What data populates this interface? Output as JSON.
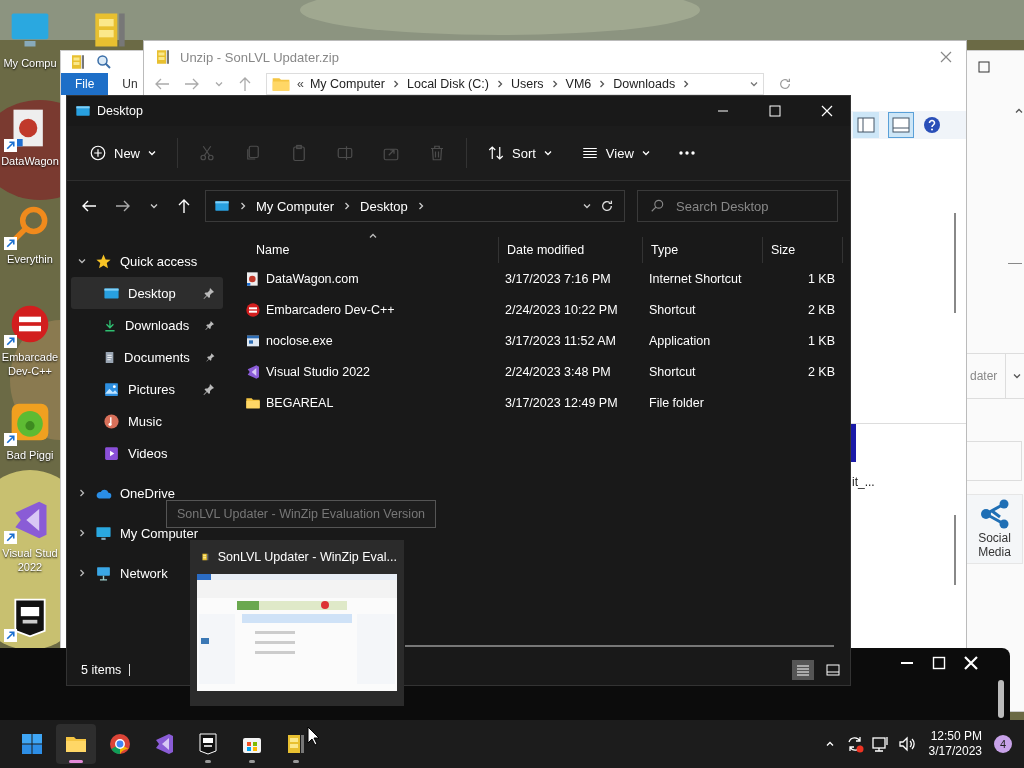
{
  "desktop_icons": [
    {
      "label": "My Compu",
      "kind": "computer",
      "shortcut": false
    },
    {
      "label": "DataWagon",
      "kind": "web",
      "shortcut": true
    },
    {
      "label": "Everythin",
      "kind": "search",
      "shortcut": true
    },
    {
      "label": "Embarcade Dev-C++",
      "kind": "devcpp",
      "shortcut": true
    },
    {
      "label": "Bad Piggi",
      "kind": "game",
      "shortcut": true
    },
    {
      "label": "Visual Stud 2022",
      "kind": "vs",
      "shortcut": true
    },
    {
      "kind": "epic",
      "shortcut": true
    }
  ],
  "winzip_window": {
    "ribbon_tabs": [
      {
        "label": "File",
        "selected": true
      },
      {
        "label": "Un",
        "selected": false
      }
    ],
    "group_label": "dater",
    "action_label": "Social Media"
  },
  "unzip_dialog": {
    "title": "Unzip - SonLVL Updater.zip",
    "overflow": "«",
    "crumbs": [
      "My Computer",
      "Local Disk (C:)",
      "Users",
      "VM6",
      "Downloads"
    ],
    "file_label": "it_..."
  },
  "explorer": {
    "title": "Desktop",
    "toolbar": [
      {
        "kind": "new",
        "label": "New",
        "disabled": false
      },
      {
        "kind": "cut",
        "disabled": true
      },
      {
        "kind": "copy",
        "disabled": true
      },
      {
        "kind": "paste",
        "disabled": true
      },
      {
        "kind": "rename",
        "disabled": true
      },
      {
        "kind": "share",
        "disabled": true
      },
      {
        "kind": "delete",
        "disabled": true
      },
      {
        "kind": "sort",
        "label": "Sort",
        "disabled": false
      },
      {
        "kind": "view",
        "label": "View",
        "disabled": false
      },
      {
        "kind": "more",
        "disabled": false
      }
    ],
    "crumbs": [
      "My Computer",
      "Desktop"
    ],
    "search": {
      "placeholder": "Search Desktop"
    },
    "sidebar": [
      {
        "label": "Quick access",
        "kind": "star",
        "expanded": true,
        "children": [
          {
            "label": "Desktop",
            "kind": "desktop",
            "pinned": true,
            "selected": true
          },
          {
            "label": "Downloads",
            "kind": "downloads",
            "pinned": true,
            "selected": false
          },
          {
            "label": "Documents",
            "kind": "documents",
            "pinned": true,
            "selected": false
          },
          {
            "label": "Pictures",
            "kind": "pictures",
            "pinned": true,
            "selected": false
          },
          {
            "label": "Music",
            "kind": "music",
            "pinned": false,
            "selected": false
          },
          {
            "label": "Videos",
            "kind": "videos",
            "pinned": false,
            "selected": false
          }
        ]
      },
      {
        "label": "OneDrive",
        "kind": "cloud",
        "expanded": false
      },
      {
        "label": "My Computer",
        "kind": "computer",
        "expanded": false
      },
      {
        "label": "Network",
        "kind": "network",
        "expanded": false
      }
    ],
    "columns": [
      {
        "label": "Name",
        "sorted": true
      },
      {
        "label": "Date modified",
        "sorted": false
      },
      {
        "label": "Type",
        "sorted": false
      },
      {
        "label": "Size",
        "sorted": false
      }
    ],
    "rows": [
      {
        "name": "DataWagon.com",
        "kind": "web",
        "date": "3/17/2023 7:16 PM",
        "type": "Internet Shortcut",
        "size": "1 KB"
      },
      {
        "name": "Embarcadero Dev-C++",
        "kind": "devcpp",
        "date": "2/24/2023 10:22 PM",
        "type": "Shortcut",
        "size": "2 KB"
      },
      {
        "name": "noclose.exe",
        "kind": "exe",
        "date": "3/17/2023 11:52 AM",
        "type": "Application",
        "size": "1 KB"
      },
      {
        "name": "Visual Studio 2022",
        "kind": "vs",
        "date": "2/24/2023 3:48 PM",
        "type": "Shortcut",
        "size": "2 KB"
      },
      {
        "name": "BEGAREAL",
        "kind": "folder",
        "date": "3/17/2023 12:49 PM",
        "type": "File folder"
      }
    ],
    "status": "5 items",
    "views": [
      {
        "kind": "details",
        "selected": true
      },
      {
        "kind": "tiles",
        "selected": false
      }
    ]
  },
  "tooltip": "SonLVL Updater - WinZip Evaluation Version",
  "thumbnail": {
    "title": "SonLVL Updater - WinZip Eval..."
  },
  "taskbar": {
    "apps": [
      {
        "kind": "start",
        "running": false,
        "selected": false
      },
      {
        "kind": "explorer",
        "running": true,
        "selected": true
      },
      {
        "kind": "chrome",
        "running": false,
        "selected": false
      },
      {
        "kind": "vs",
        "running": false,
        "selected": false
      },
      {
        "kind": "epic",
        "running": true,
        "selected": false
      },
      {
        "kind": "store",
        "running": true,
        "selected": false
      },
      {
        "kind": "winzip",
        "running": true,
        "selected": false
      }
    ],
    "time": "12:50 PM",
    "date": "3/17/2023",
    "notifications": "4"
  }
}
